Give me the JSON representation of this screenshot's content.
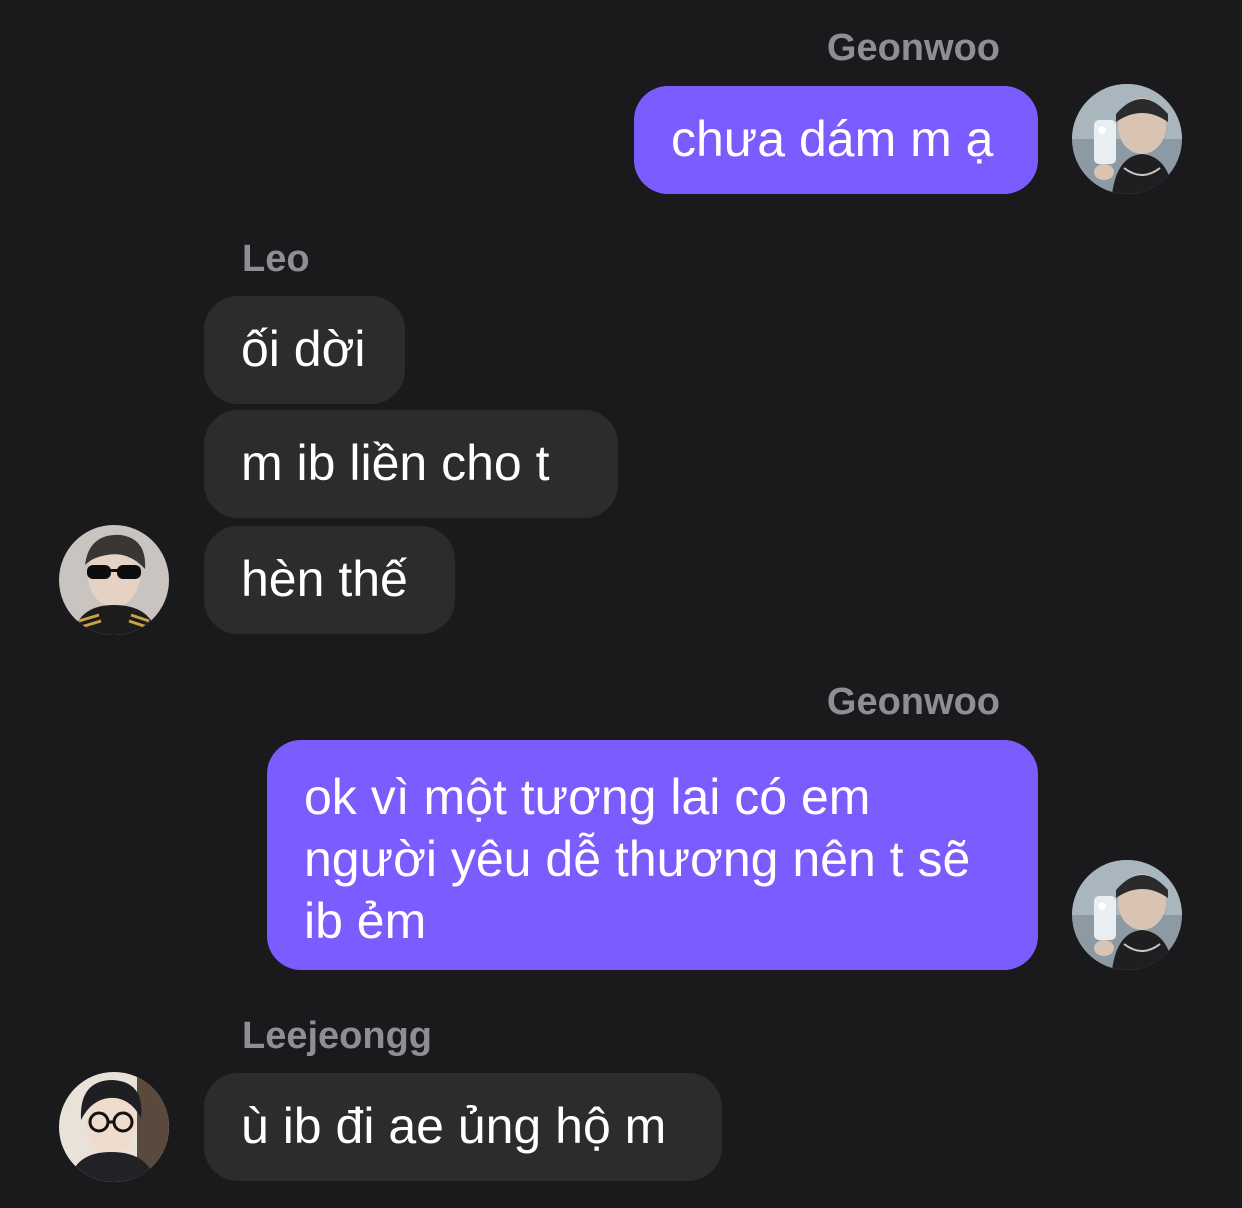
{
  "messages": [
    {
      "sender": "Geonwoo",
      "text": "chưa dám m ạ",
      "direction": "outgoing"
    },
    {
      "sender": "Leo",
      "text": "ối dời",
      "direction": "incoming"
    },
    {
      "sender": "Leo",
      "text": "m ib liền cho t",
      "direction": "incoming"
    },
    {
      "sender": "Leo",
      "text": "hèn thế",
      "direction": "incoming"
    },
    {
      "sender": "Geonwoo",
      "text": "ok vì một tương lai có em người yêu dễ thương nên t sẽ ib ẻm",
      "direction": "outgoing"
    },
    {
      "sender": "Leejeongg",
      "text": "ù ib đi ae ủng hộ m",
      "direction": "incoming"
    }
  ],
  "colors": {
    "background": "#1a1a1c",
    "outgoing_bubble": "#7b5cff",
    "incoming_bubble": "#2c2c2e",
    "sender_name": "#8e8e93",
    "message_text": "#ffffff"
  },
  "avatars": {
    "geonwoo": "mirror-selfie-photo",
    "leo": "sunglasses-portrait-photo",
    "leejeongg": "glasses-portrait-photo"
  }
}
